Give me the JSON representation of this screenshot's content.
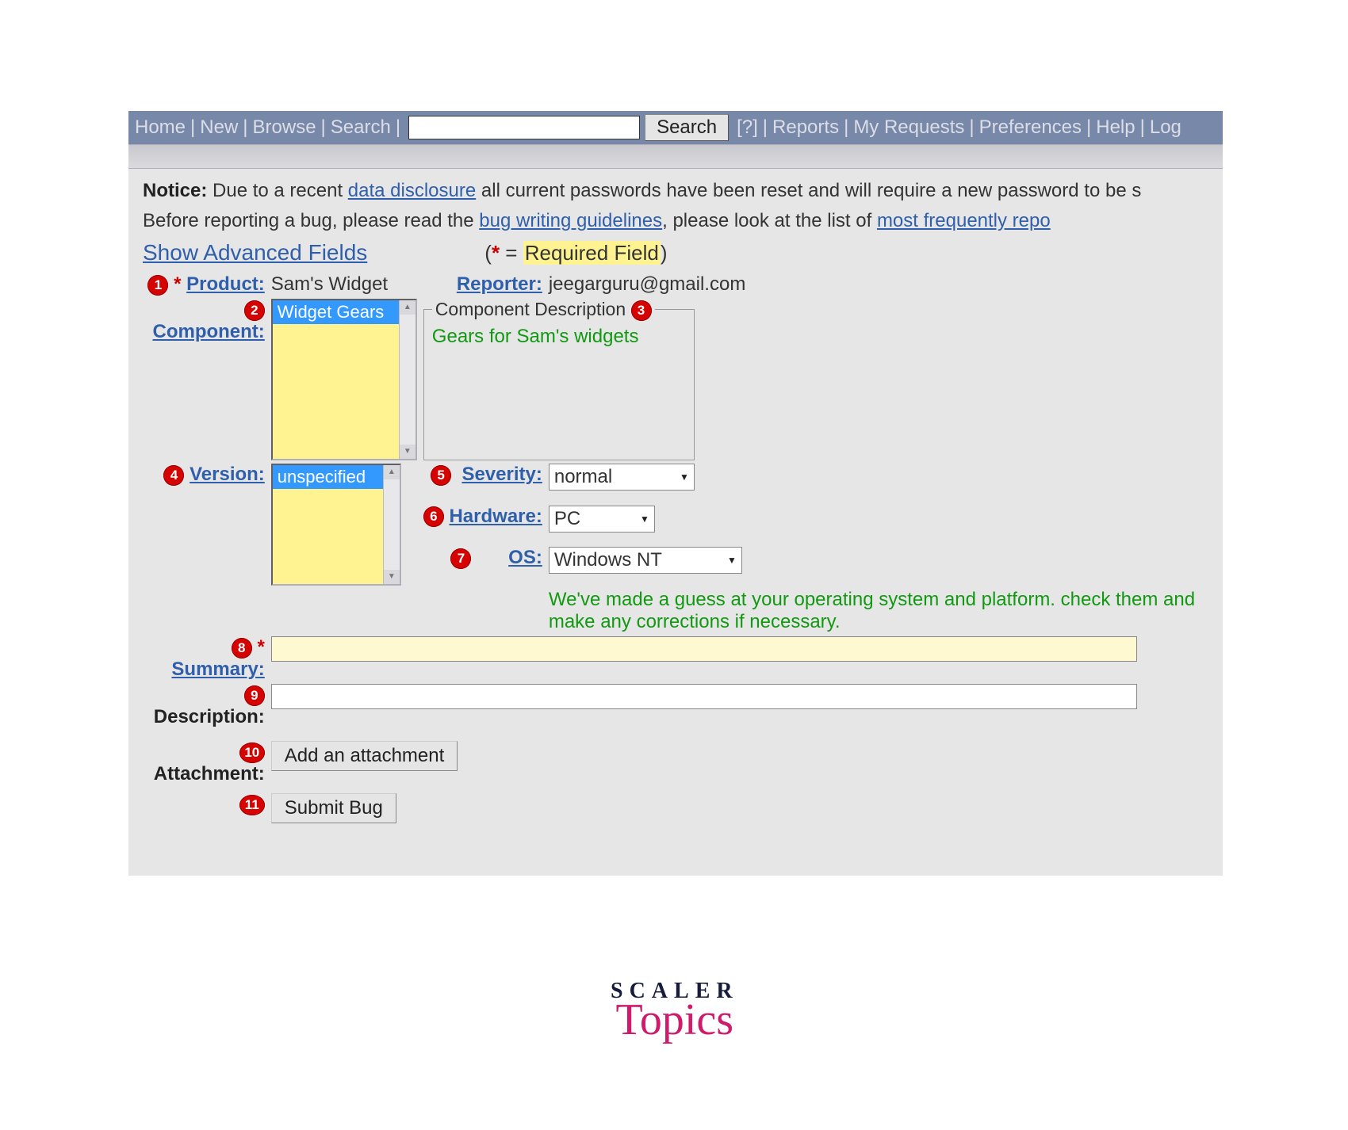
{
  "nav": {
    "home": "Home",
    "new": "New",
    "browse": "Browse",
    "search": "Search",
    "searchbtn": "Search",
    "help_q": "[?]",
    "reports": "Reports",
    "myreq": "My Requests",
    "prefs": "Preferences",
    "help": "Help",
    "log": "Log"
  },
  "notice": {
    "label": "Notice:",
    "line1a": " Due to a recent ",
    "link1": "data disclosure",
    "line1b": " all current passwords have been reset and will require a new password to be s",
    "line2a": "Before reporting a bug, please read the ",
    "link2": "bug writing guidelines",
    "line2b": ", please look at the list of ",
    "link3": "most frequently repo"
  },
  "adv": "Show Advanced Fields",
  "reqnote": {
    "prefix": "(",
    "star": "*",
    "eq": " = ",
    "label": "Required Field",
    "suffix": ")"
  },
  "labels": {
    "product": "Product:",
    "reporter": "Reporter:",
    "component": "Component:",
    "version": "Version:",
    "severity": "Severity:",
    "hardware": "Hardware:",
    "os": "OS:",
    "summary": "Summary:",
    "description": "Description:",
    "attachment": "Attachment:"
  },
  "values": {
    "product": "Sam's Widget",
    "reporter": "jeegarguru@gmail.com",
    "componentSel": "Widget Gears",
    "compDescLegend": "Component Description",
    "compDesc": "Gears for Sam's widgets",
    "versionSel": "unspecified",
    "severity": "normal",
    "hardware": "PC",
    "os": "Windows NT",
    "oshint": "We've made a guess at your operating system and platform. check them and make any corrections if necessary."
  },
  "buttons": {
    "addattach": "Add an attachment",
    "submit": "Submit Bug"
  },
  "nums": {
    "1": "1",
    "2": "2",
    "3": "3",
    "4": "4",
    "5": "5",
    "6": "6",
    "7": "7",
    "8": "8",
    "9": "9",
    "10": "10",
    "11": "11"
  },
  "brand": {
    "l1": "SCALER",
    "l2": "Topics"
  }
}
